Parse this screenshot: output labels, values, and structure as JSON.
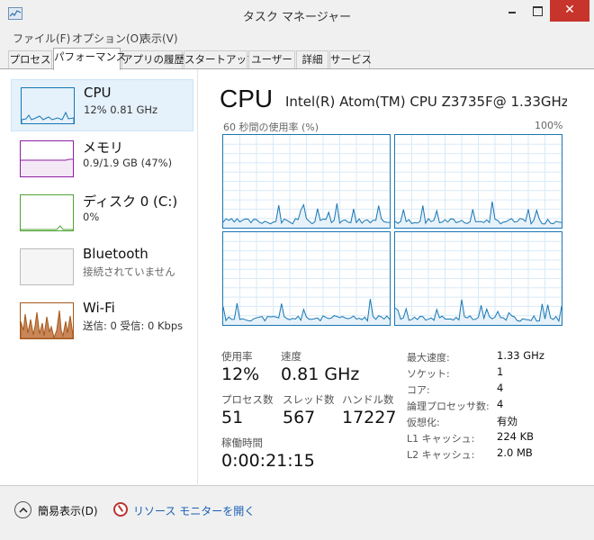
{
  "window": {
    "title": "タスク マネージャー",
    "close_glyph": "✕"
  },
  "menu": [
    "ファイル(F)",
    "オプション(O)",
    "表示(V)"
  ],
  "tabs": [
    "プロセス",
    "パフォーマンス",
    "アプリの履歴",
    "スタートアップ",
    "ユーザー",
    "詳細",
    "サービス"
  ],
  "active_tab": "パフォーマンス",
  "sidebar": [
    {
      "title": "CPU",
      "sub": "12%  0.81 GHz",
      "color": "#1777b4",
      "selected": true
    },
    {
      "title": "メモリ",
      "sub": "0.9/1.9 GB (47%)",
      "color": "#8b1ea3"
    },
    {
      "title": "ディスク 0 (C:)",
      "sub": "0%",
      "color": "#4ca333"
    },
    {
      "title": "Bluetooth",
      "sub": "接続されていません",
      "color": "#999999"
    },
    {
      "title": "Wi-Fi",
      "sub": "送信: 0  受信: 0 Kbps",
      "color": "#a7581a"
    }
  ],
  "main": {
    "title": "CPU",
    "model": "Intel(R) Atom(TM) CPU Z3735F@ 1.33GHz",
    "graph_label": "60 秒間の使用率 (%)",
    "graph_max": "100%",
    "stats": {
      "utilization_label": "使用率",
      "utilization": "12%",
      "speed_label": "速度",
      "speed": "0.81 GHz",
      "processes_label": "プロセス数",
      "processes": "51",
      "threads_label": "スレッド数",
      "threads": "567",
      "handles_label": "ハンドル数",
      "handles": "17227",
      "uptime_label": "稼働時間",
      "uptime": "0:00:21:15"
    },
    "props": [
      {
        "label": "最大速度:",
        "value": "1.33 GHz"
      },
      {
        "label": "ソケット:",
        "value": "1"
      },
      {
        "label": "コア:",
        "value": "4"
      },
      {
        "label": "論理プロセッサ数:",
        "value": "4"
      },
      {
        "label": "仮想化:",
        "value": "有効"
      },
      {
        "label": "L1 キャッシュ:",
        "value": "224 KB"
      },
      {
        "label": "L2 キャッシュ:",
        "value": "2.0 MB"
      }
    ]
  },
  "footer": {
    "simple": "簡易表示(D)",
    "resource_monitor": "リソース モニターを開く"
  },
  "colors": {
    "cpu": "#1777b4",
    "memory": "#8b1ea3",
    "disk": "#4ca333",
    "wifi": "#a7581a",
    "link": "#1a5fb4"
  },
  "icons": [
    "task-manager-icon",
    "minimize-icon",
    "maximize-icon",
    "close-icon",
    "chevron-up-icon",
    "resource-monitor-icon"
  ]
}
